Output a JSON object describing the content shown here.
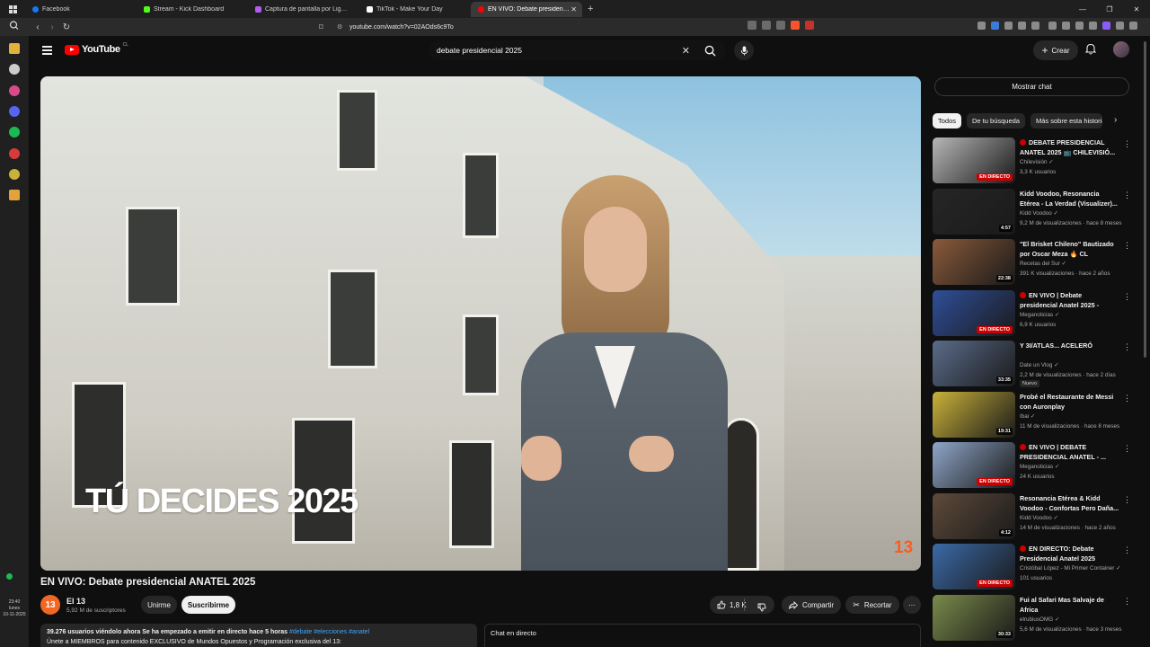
{
  "browser": {
    "tabs": [
      {
        "title": "Facebook",
        "color": "#1877f2"
      },
      {
        "title": "Stream - Kick Dashboard",
        "color": "#53fc18"
      },
      {
        "title": "Captura de pantalla por Lightshot",
        "color": "#b45cf0"
      },
      {
        "title": "TikTok - Make Your Day",
        "color": "#ffffff"
      },
      {
        "title": "EN VIVO: Debate presidencial AN...",
        "color": "#ff0000"
      }
    ],
    "url": "youtube.com/watch?v=02AOds6c9To",
    "clock": {
      "time": "23:40",
      "day": "lunes",
      "date": "10-11-2025"
    }
  },
  "header": {
    "logo_text": "YouTube",
    "country": "CL",
    "search_value": "debate presidencial 2025",
    "create_label": "Crear"
  },
  "video": {
    "overlay": "TÚ DECIDES 2025",
    "channel_bug": "13",
    "title": "EN VIVO: Debate presidencial ANATEL 2025",
    "channel": "El 13",
    "subscribers": "5,92 M de suscriptores",
    "join_label": "Unirme",
    "subscribe_label": "Suscribirme",
    "likes": "1,8 K",
    "share_label": "Compartir",
    "clip_label": "Recortar",
    "desc_line1_stats": "39.276 usuarios viéndolo ahora  Se ha empezado a emitir en directo hace 5 horas",
    "desc_line1_tags": " #debate #elecciones #anatel",
    "desc_line2": "Únete a MIEMBROS para contenido EXCLUSIVO de Mundos Opuestos y Programación exclusiva del 13:",
    "chat_label": "Chat en directo"
  },
  "sidebar": {
    "show_chat": "Mostrar chat",
    "chips": [
      "Todos",
      "De tu búsqueda",
      "Más sobre esta historia"
    ],
    "recs": [
      {
        "title": "DEBATE PRESIDENCIAL ANATEL 2025 📺 CHILEVISIÓ...",
        "channel": "Chilevisión",
        "meta": "3,3 K usuarios",
        "badge": "EN DIRECTO",
        "live": true,
        "thumb": "#b7b7b7"
      },
      {
        "title": "Kidd Voodoo, Resonancia Etérea - La Verdad (Visualizer)...",
        "channel": "Kidd Voodoo",
        "meta": "9,2 M de visualizaciones · hace 8 meses",
        "badge": "4:57",
        "live": false,
        "thumb": "#262626"
      },
      {
        "title": "\"El Brisket Chileno\" Bautizado por Oscar Meza 🔥 CL",
        "channel": "Recetas del Sur",
        "meta": "391 K visualizaciones · hace 2 años",
        "badge": "22:38",
        "live": false,
        "thumb": "#8a5a3a"
      },
      {
        "title": "EN VIVO | Debate presidencial Anatel 2025 - Análisis en ...",
        "channel": "Meganoticias",
        "meta": "6,9 K usuarios",
        "badge": "EN DIRECTO",
        "live": true,
        "thumb": "#2f4f9a"
      },
      {
        "title": "Y 3I/ATLAS... ACELERÓ",
        "channel": "Date un Vlog",
        "meta": "2,2 M de visualizaciones · hace 2 días",
        "badge": "33:35",
        "live": false,
        "new": "Nuevo",
        "thumb": "#5a6c8a"
      },
      {
        "title": "Probé el Restaurante de Messi con Auronplay",
        "channel": "Ibai",
        "meta": "11 M de visualizaciones · hace 8 meses",
        "badge": "19:31",
        "live": false,
        "thumb": "#c9b23a"
      },
      {
        "title": "EN VIVO | DEBATE PRESIDENCIAL ANATEL - ...",
        "channel": "Meganoticias",
        "meta": "24 K usuarios",
        "badge": "EN DIRECTO",
        "live": true,
        "thumb": "#8fa6c9"
      },
      {
        "title": "Resonancia Etérea & Kidd Voodoo - Confortas Pero Daña...",
        "channel": "Kidd Voodoo",
        "meta": "14 M de visualizaciones · hace 2 años",
        "badge": "4:12",
        "live": false,
        "thumb": "#5e4a3a"
      },
      {
        "title": "EN DIRECTO: Debate Presidencial Anatel 2025",
        "channel": "Cristóbal López - Mi Primer Container",
        "meta": "101 usuarios",
        "badge": "EN DIRECTO",
        "live": true,
        "thumb": "#3b6aa8"
      },
      {
        "title": "Fui al Safari Mas Salvaje de Africa",
        "channel": "elrubiusOMG",
        "meta": "5,6 M de visualizaciones · hace 3 meses",
        "badge": "30:33",
        "live": false,
        "thumb": "#7a8a4a"
      }
    ]
  }
}
